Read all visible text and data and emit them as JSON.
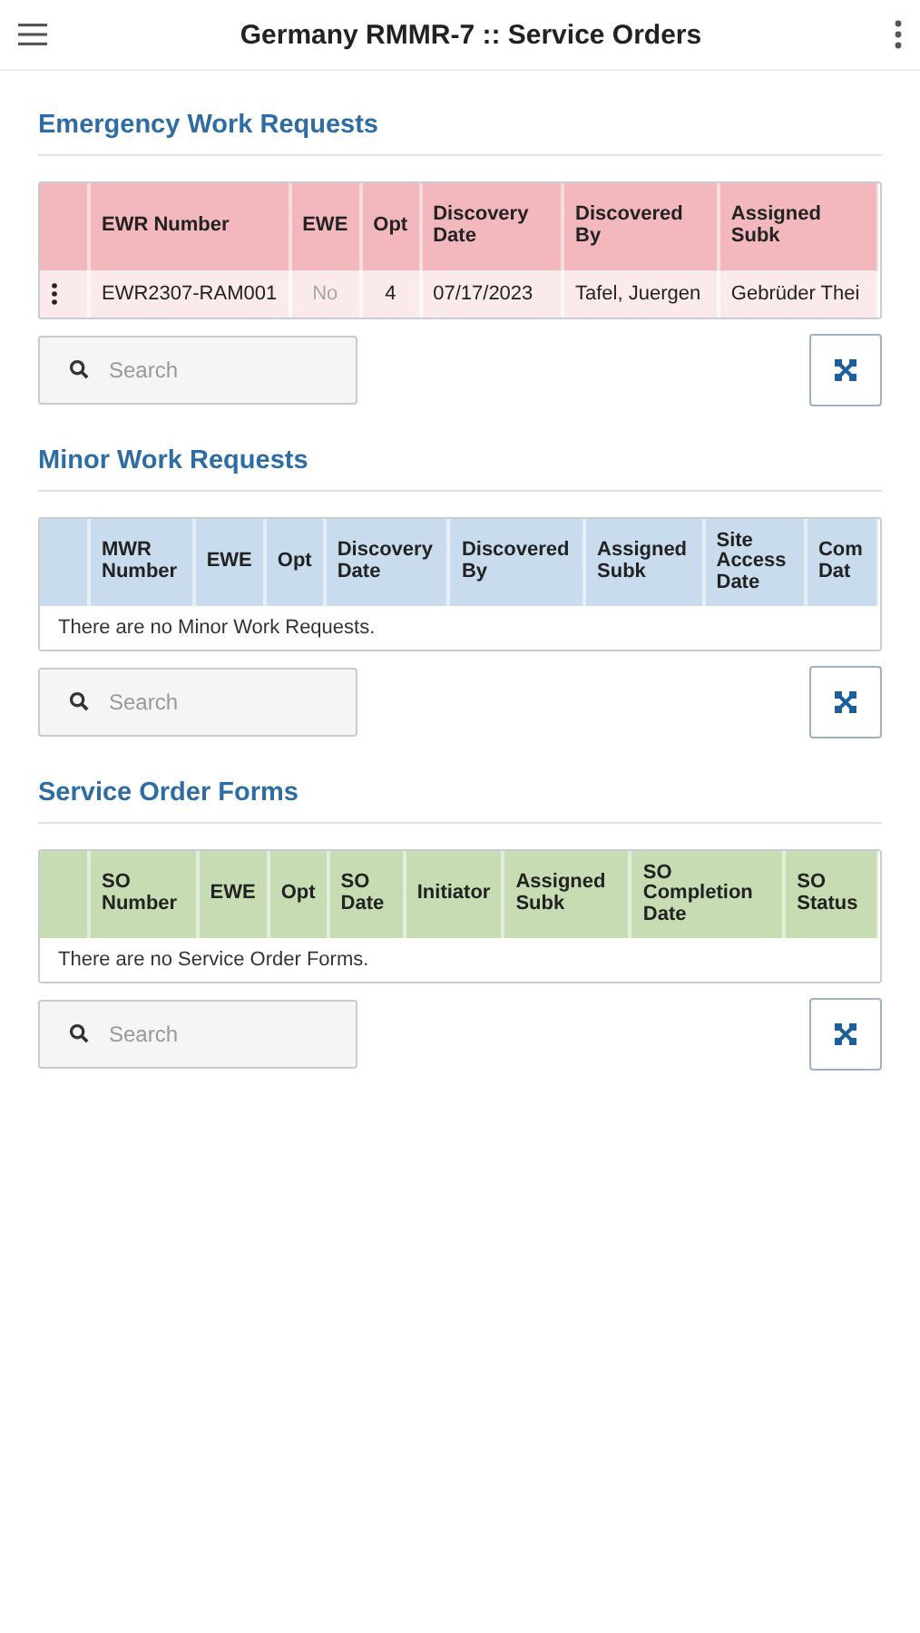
{
  "app_bar": {
    "title": "Germany RMMR-7 :: Service Orders"
  },
  "sections": [
    {
      "title": "Emergency Work Requests",
      "color": "#f2b8bd",
      "columns": [
        "EWR Number",
        "EWE",
        "Opt",
        "Discovery Date",
        "Discovered By",
        "Assigned Subk"
      ],
      "rows": [
        {
          "cells": [
            {
              "text": "EWR2307-RAM001",
              "dimmed": false
            },
            {
              "text": "No",
              "dimmed": true
            },
            {
              "text": "4",
              "dimmed": false
            },
            {
              "text": "07/17/2023",
              "dimmed": false
            },
            {
              "text": "Tafel, Juergen",
              "dimmed": false
            },
            {
              "text": "Gebrüder Thei",
              "dimmed": false
            }
          ]
        }
      ],
      "search": {
        "placeholder": "Search"
      }
    },
    {
      "title": "Minor Work Requests",
      "color": "#c9dcee",
      "columns": [
        "MWR Number",
        "EWE",
        "Opt",
        "Discovery Date",
        "Discovered By",
        "Assigned Subk",
        "Site Access Date",
        "Com Dat"
      ],
      "empty_message": "There are no Minor Work Requests.",
      "search": {
        "placeholder": "Search"
      }
    },
    {
      "title": "Service Order Forms",
      "color": "#c7dcb3",
      "columns": [
        "SO Number",
        "EWE",
        "Opt",
        "SO Date",
        "Initiator",
        "Assigned Subk",
        "SO Completion Date",
        "SO Status"
      ],
      "empty_message": "There are no Service Order Forms.",
      "search": {
        "placeholder": "Search"
      }
    }
  ]
}
